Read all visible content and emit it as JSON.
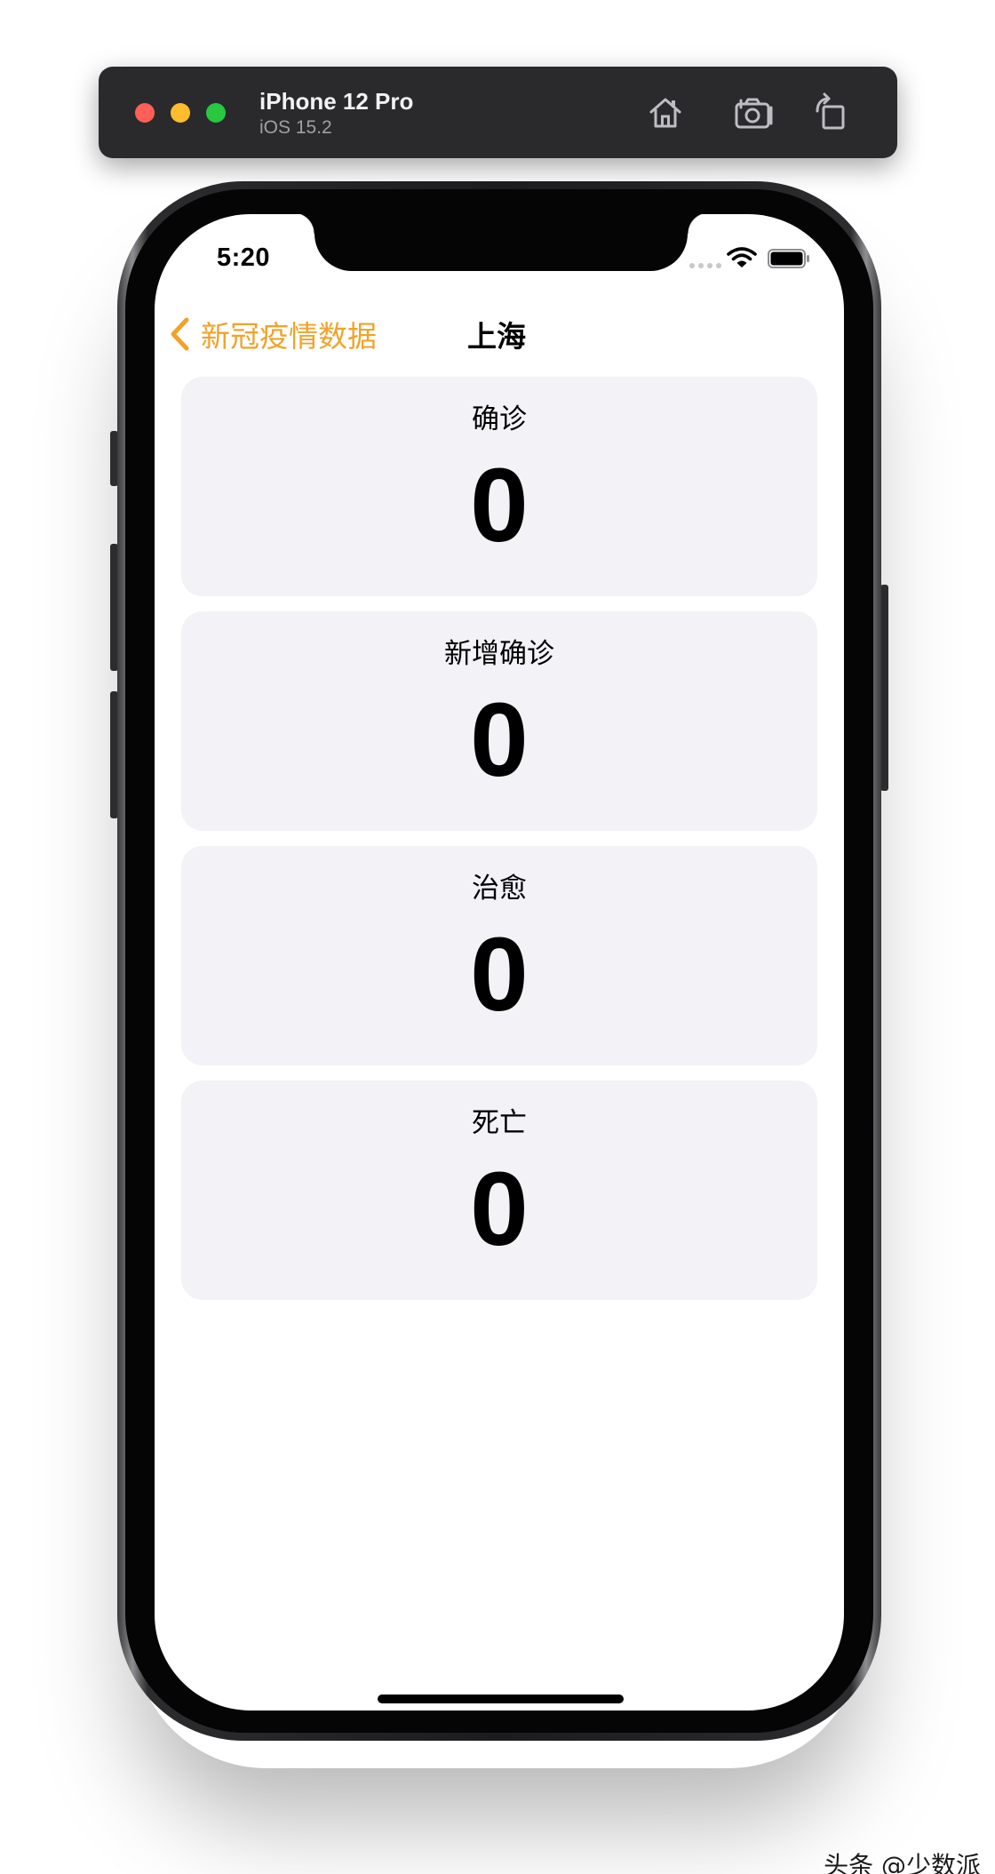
{
  "simulator": {
    "device_name": "iPhone 12 Pro",
    "os_version": "iOS 15.2",
    "toolbar_icons": [
      "home-icon",
      "screenshot-icon",
      "rotate-icon"
    ]
  },
  "status_bar": {
    "time": "5:20",
    "icons": [
      "signal-icon",
      "wifi-icon",
      "battery-icon"
    ]
  },
  "nav": {
    "back_label": "新冠疫情数据",
    "title": "上海",
    "accent_color": "#f0a32a"
  },
  "stats": [
    {
      "label": "确诊",
      "value": "0"
    },
    {
      "label": "新增确诊",
      "value": "0"
    },
    {
      "label": "治愈",
      "value": "0"
    },
    {
      "label": "死亡",
      "value": "0"
    }
  ],
  "colors": {
    "card_background": "#f2f2f7",
    "toolbar_background": "#2a2a2c"
  },
  "watermark": "头条 @少数派"
}
